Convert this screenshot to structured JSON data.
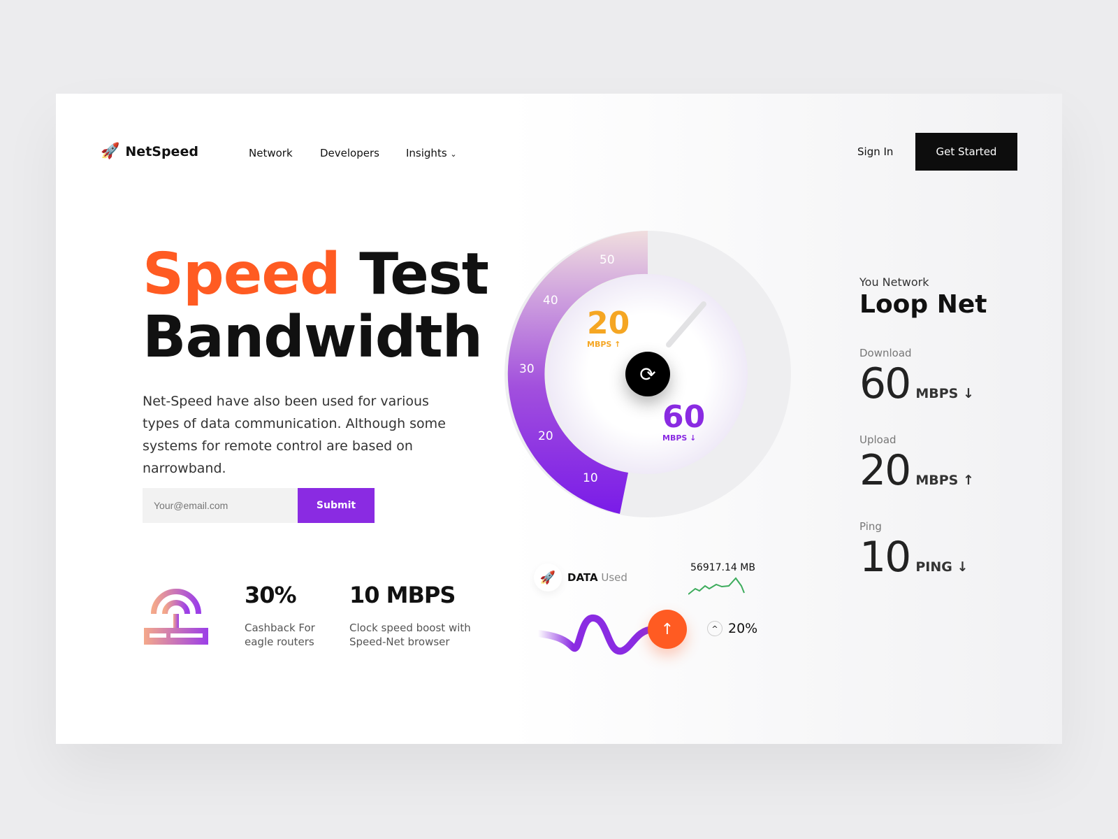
{
  "brand": {
    "name": "NetSpeed"
  },
  "nav": {
    "items": [
      "Network",
      "Developers",
      "Insights"
    ],
    "sign_in": "Sign In",
    "get_started": "Get Started"
  },
  "hero": {
    "title_accent": "Speed",
    "title_rest": "Test",
    "title_line2": "Bandwidth",
    "description": "Net-Speed have also been used for various types of data communication. Although some systems for remote control are based on narrowband.",
    "email_placeholder": "Your@email.com",
    "submit": "Submit"
  },
  "stats": [
    {
      "value": "30%",
      "label": "Cashback For eagle routers"
    },
    {
      "value": "10 MBPS",
      "label": "Clock speed boost with Speed-Net browser"
    }
  ],
  "gauge": {
    "ticks": [
      "10",
      "20",
      "30",
      "40",
      "50"
    ],
    "upload_value": "20",
    "upload_unit": "MBPS ↑",
    "download_value": "60",
    "download_unit": "MBPS ↓",
    "upload_color": "#f5a623",
    "download_color": "#8a2be2"
  },
  "data_used": {
    "label_bold": "DATA",
    "label_rest": "Used",
    "amount": "56917.14 MB",
    "change": "20%"
  },
  "network": {
    "label": "You Network",
    "name": "Loop Net",
    "download_label": "Download",
    "download_value": "60",
    "download_unit": "MBPS ↓",
    "upload_label": "Upload",
    "upload_value": "20",
    "upload_unit": "MBPS ↑",
    "ping_label": "Ping",
    "ping_value": "10",
    "ping_unit": "PING ↓"
  },
  "colors": {
    "accent": "#ff5b22",
    "purple": "#8a2be2"
  }
}
